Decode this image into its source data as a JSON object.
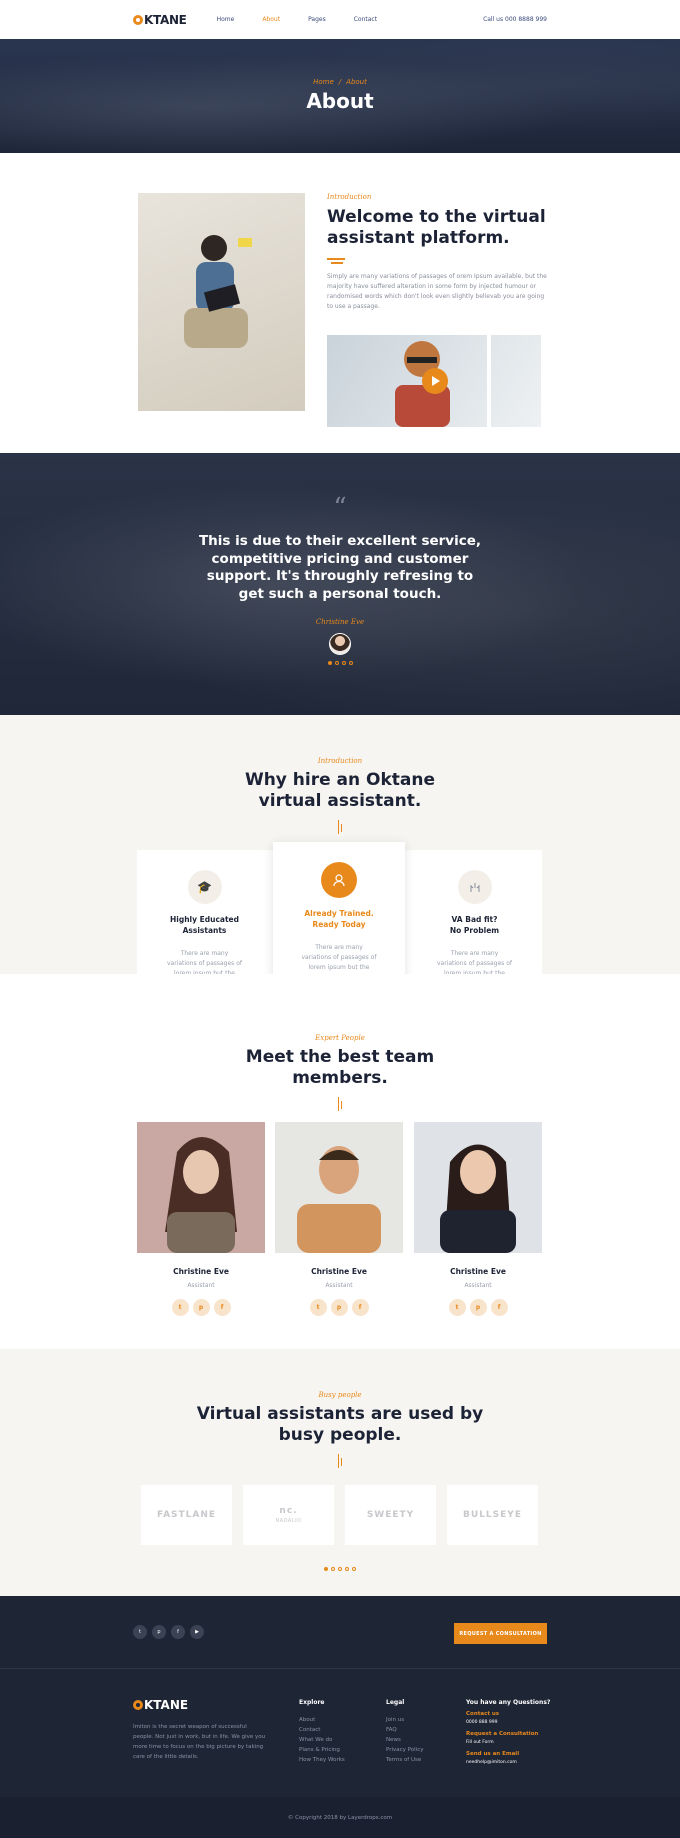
{
  "brand": {
    "name": "KTANE",
    "accent": "#e8891c",
    "dark": "#1d2336"
  },
  "header": {
    "nav": [
      "Home",
      "About",
      "Pages",
      "Contact"
    ],
    "active": "About",
    "call": "Call us 000 8888 999"
  },
  "hero": {
    "crumb_home": "Home",
    "crumb_current": "About",
    "title": "About"
  },
  "intro": {
    "kicker": "Introduction",
    "title": "Welcome to the virtual assistant platform.",
    "body": "Simply are many variations of passages of orem Ipsum available, but the majority have suffered alteration in some form by injected humour or randomised words which don't look even slightly believab you are going to use a passage."
  },
  "testimonial": {
    "text": "This is due to their excellent service, competitive pricing and customer support. It's throughly refresing to get such a personal touch.",
    "name": "Christine Eve"
  },
  "why": {
    "kicker": "Introduction",
    "title_line1": "Why hire an Oktane",
    "title_line2": "virtual assistant.",
    "features": [
      {
        "title_line1": "Highly Educated",
        "title_line2": "Assistants",
        "text": "There are many variations of passages of lorem ipsum but the majority."
      },
      {
        "title_line1": "Already Trained.",
        "title_line2": "Ready Today",
        "text": "There are many variations of passages of lorem ipsum but the majority."
      },
      {
        "title_line1": "VA Bad fit?",
        "title_line2": "No Problem",
        "text": "There are many variations of passages of lorem ipsum but the majority."
      }
    ]
  },
  "team": {
    "kicker": "Expert People",
    "title_line1": "Meet the best team",
    "title_line2": "members.",
    "members": [
      {
        "name": "Christine Eve",
        "role": "Assistant"
      },
      {
        "name": "Christine Eve",
        "role": "Assistant"
      },
      {
        "name": "Christine Eve",
        "role": "Assistant"
      }
    ],
    "social_icons": [
      "twitter-icon",
      "pinterest-icon",
      "facebook-icon"
    ]
  },
  "busy": {
    "kicker": "Busy people",
    "title_line1": "Virtual assistants are used by",
    "title_line2": "busy people.",
    "logos": [
      {
        "name": "FASTLANE",
        "sub": ""
      },
      {
        "name": "nc.",
        "sub": "NADALIO"
      },
      {
        "name": "SWEETY",
        "sub": ""
      },
      {
        "name": "BULLSEYE",
        "sub": ""
      }
    ]
  },
  "footer": {
    "cta": "REQUEST A CONSULTATION",
    "social_icons": [
      "twitter-icon",
      "pinterest-icon",
      "facebook-icon",
      "youtube-icon"
    ],
    "about": "Imiton is the secret weapon of successful people. Not just in work, but in life. We give you more time to focus on the big picture by taking care of the little details.",
    "explore_title": "Explore",
    "explore": [
      "About",
      "Contact",
      "What We do",
      "Plans & Pricing",
      "How They Works"
    ],
    "legal_title": "Legal",
    "legal": [
      "Join us",
      "FAQ",
      "News",
      "Privacy Policy",
      "Terms of Use"
    ],
    "contact_title": "You have any Questions?",
    "contact": [
      {
        "label": "Contact us",
        "value": "0000 888 999"
      },
      {
        "label": "Request a Consultation",
        "value": "Fill out Form"
      },
      {
        "label": "Send us an Email",
        "value": "needhelp@imiton.com"
      }
    ],
    "copyright": "© Copyright 2018 by Layerdrops.com"
  }
}
